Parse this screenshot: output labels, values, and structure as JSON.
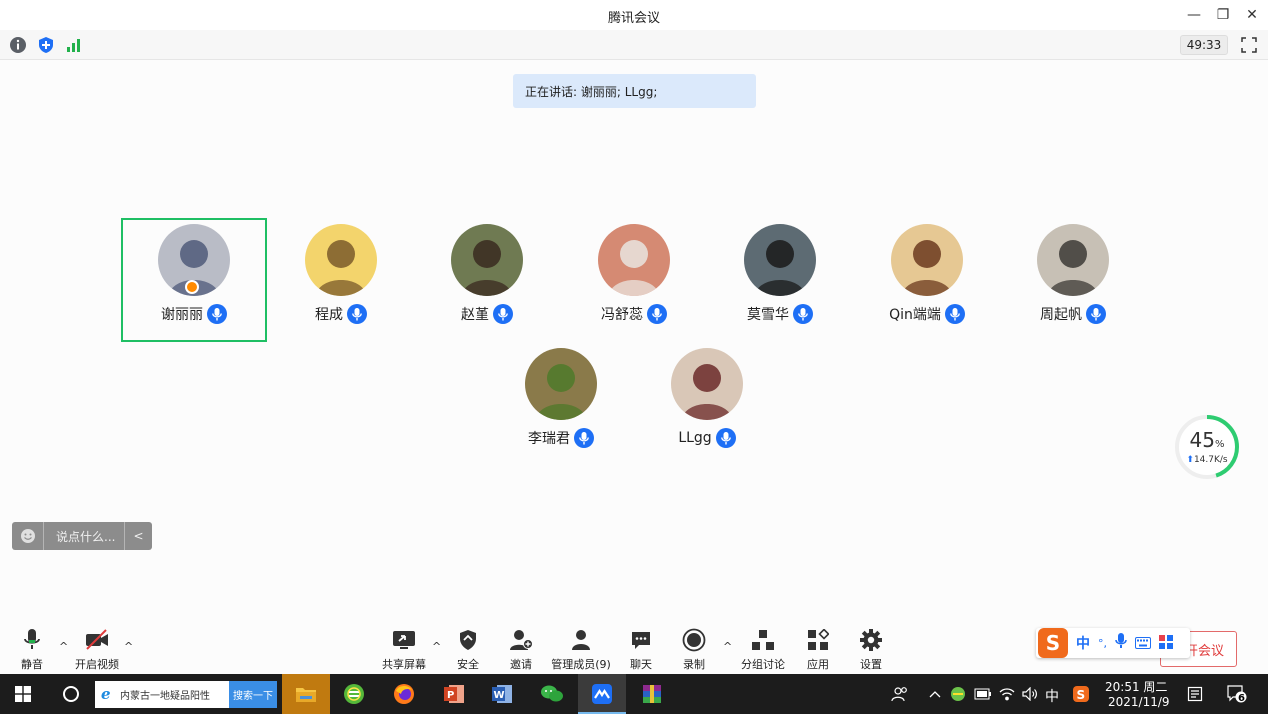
{
  "window": {
    "title": "腾讯会议",
    "minimize_glyph": "—",
    "restore_glyph": "❐",
    "close_glyph": "✕"
  },
  "infobar": {
    "icons": [
      "info-icon",
      "shield-icon",
      "signal-icon"
    ],
    "timer": "49:33"
  },
  "speaking": {
    "text": "正在讲话: 谢丽丽; LLgg;"
  },
  "participants": [
    {
      "name": "谢丽丽",
      "active": true,
      "host": true,
      "avatar_bg": "#b9bcc6",
      "avatar_fg": "#4f5a79"
    },
    {
      "name": "程成",
      "active": false,
      "host": false,
      "avatar_bg": "#f3d46c",
      "avatar_fg": "#7a5a2a"
    },
    {
      "name": "赵堇",
      "active": false,
      "host": false,
      "avatar_bg": "#6f7a52",
      "avatar_fg": "#3a2a20"
    },
    {
      "name": "冯舒蕊",
      "active": false,
      "host": false,
      "avatar_bg": "#d58a73",
      "avatar_fg": "#e9e4df"
    },
    {
      "name": "莫雪华",
      "active": false,
      "host": false,
      "avatar_bg": "#5d6b73",
      "avatar_fg": "#1a1a1a"
    },
    {
      "name": "Qin端端",
      "active": false,
      "host": false,
      "avatar_bg": "#e6c893",
      "avatar_fg": "#6b3a1e"
    },
    {
      "name": "周起帆",
      "active": false,
      "host": false,
      "avatar_bg": "#c7c0b5",
      "avatar_fg": "#3c3a36"
    },
    {
      "name": "李瑞君",
      "active": false,
      "host": false,
      "avatar_bg": "#8a7a4a",
      "avatar_fg": "#4e7a2a"
    },
    {
      "name": "LLgg",
      "active": false,
      "host": false,
      "avatar_bg": "#d9c7b7",
      "avatar_fg": "#6b2a2a"
    }
  ],
  "chat": {
    "placeholder": "说点什么...",
    "arrow": "<"
  },
  "network": {
    "percent": "45",
    "percent_unit": "%",
    "upload": "14.7K/s",
    "progress": 0.45,
    "color": "#2ecc71"
  },
  "toolbar": {
    "mute": "静音",
    "video": "开启视频",
    "share": "共享屏幕",
    "security": "安全",
    "invite": "邀请",
    "members": "管理成员(9)",
    "chat": "聊天",
    "record": "录制",
    "breakout": "分组讨论",
    "apps": "应用",
    "settings": "设置",
    "leave": "离开会议",
    "caret": "^"
  },
  "ime": {
    "logo": "S",
    "mode": "中",
    "punct": "°,",
    "items": [
      "microphone-icon",
      "keyboard-icon",
      "grid-icon"
    ]
  },
  "taskbar": {
    "search_text": "内蒙古一地疑品阳性",
    "search_button": "搜索一下",
    "apps": [
      "file-explorer-icon",
      "browser-360-icon",
      "firefox-icon",
      "powerpoint-icon",
      "word-icon",
      "wechat-icon",
      "tencent-meeting-icon",
      "winrar-icon"
    ],
    "ime_indicator": "中",
    "time": "20:51 周二",
    "date": "2021/11/9",
    "notifications": "6"
  },
  "colors": {
    "accent": "#1e6ff5",
    "active_border": "#1fbf64",
    "leave": "#e03c3c",
    "speaking_bg": "#dbe9fb"
  }
}
